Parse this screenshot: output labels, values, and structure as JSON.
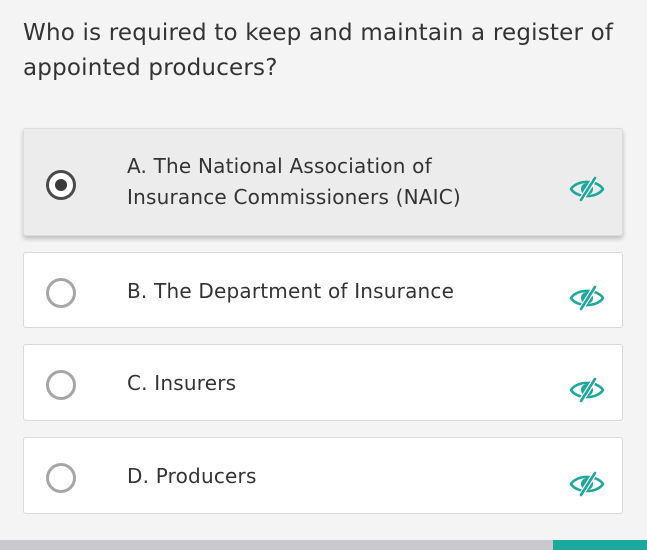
{
  "question": {
    "text": "Who is required to keep and maintain a register of appointed producers?"
  },
  "options": [
    {
      "label": "A. The National Association of Insurance Commissioners (NAIC)",
      "selected": true,
      "eye_icon": "eye-off-icon"
    },
    {
      "label": "B. The Department of Insurance",
      "selected": false,
      "eye_icon": "eye-off-icon"
    },
    {
      "label": "C. Insurers",
      "selected": false,
      "eye_icon": "eye-off-icon"
    },
    {
      "label": "D. Producers",
      "selected": false,
      "eye_icon": "eye-off-icon"
    }
  ],
  "colors": {
    "accent": "#1aa99c",
    "eye_icon": "#1aa99c",
    "progress_track": "#c8c8cd"
  },
  "progress": {
    "fill_start_fraction": 0.855,
    "fill_end_fraction": 1.0
  }
}
